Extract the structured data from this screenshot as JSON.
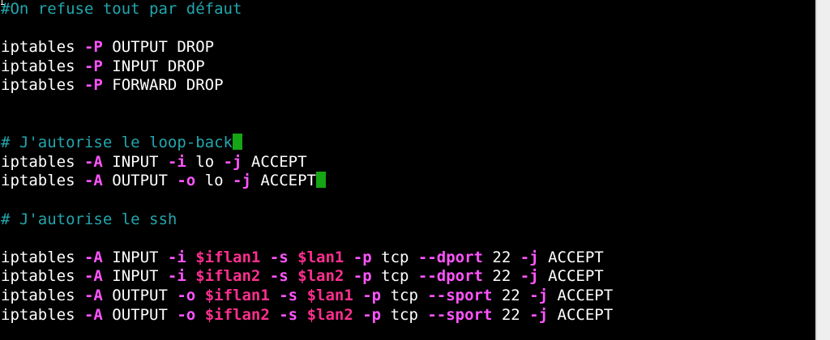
{
  "editor": {
    "lines": [
      [
        {
          "text": "#On refuse tout par défaut",
          "kind": "comment"
        }
      ],
      [],
      [
        {
          "text": "iptables ",
          "kind": "plain"
        },
        {
          "text": "-P",
          "kind": "option"
        },
        {
          "text": " OUTPUT DROP",
          "kind": "plain"
        }
      ],
      [
        {
          "text": "iptables ",
          "kind": "plain"
        },
        {
          "text": "-P",
          "kind": "option"
        },
        {
          "text": " INPUT DROP",
          "kind": "plain"
        }
      ],
      [
        {
          "text": "iptables ",
          "kind": "plain"
        },
        {
          "text": "-P",
          "kind": "option"
        },
        {
          "text": " FORWARD DROP",
          "kind": "plain"
        }
      ],
      [],
      [],
      [
        {
          "text": "# J'autorise le loop-back",
          "kind": "comment"
        },
        {
          "kind": "cursor"
        }
      ],
      [
        {
          "text": "iptables ",
          "kind": "plain"
        },
        {
          "text": "-A",
          "kind": "option"
        },
        {
          "text": " INPUT ",
          "kind": "plain"
        },
        {
          "text": "-i",
          "kind": "option"
        },
        {
          "text": " lo ",
          "kind": "plain"
        },
        {
          "text": "-j",
          "kind": "option"
        },
        {
          "text": " ACCEPT",
          "kind": "plain"
        }
      ],
      [
        {
          "text": "iptables ",
          "kind": "plain"
        },
        {
          "text": "-A",
          "kind": "option"
        },
        {
          "text": " OUTPUT ",
          "kind": "plain"
        },
        {
          "text": "-o",
          "kind": "option"
        },
        {
          "text": " lo ",
          "kind": "plain"
        },
        {
          "text": "-j",
          "kind": "option"
        },
        {
          "text": " ACCEPT",
          "kind": "plain"
        },
        {
          "kind": "cursor"
        }
      ],
      [],
      [
        {
          "text": "# J'autorise le ssh",
          "kind": "comment"
        }
      ],
      [],
      [
        {
          "text": "iptables ",
          "kind": "plain"
        },
        {
          "text": "-A",
          "kind": "option"
        },
        {
          "text": " INPUT ",
          "kind": "plain"
        },
        {
          "text": "-i",
          "kind": "option"
        },
        {
          "text": " ",
          "kind": "plain"
        },
        {
          "text": "$iflan1",
          "kind": "variable"
        },
        {
          "text": " ",
          "kind": "plain"
        },
        {
          "text": "-s",
          "kind": "option"
        },
        {
          "text": " ",
          "kind": "plain"
        },
        {
          "text": "$lan1",
          "kind": "variable"
        },
        {
          "text": " ",
          "kind": "plain"
        },
        {
          "text": "-p",
          "kind": "option"
        },
        {
          "text": " tcp ",
          "kind": "plain"
        },
        {
          "text": "--dport",
          "kind": "option"
        },
        {
          "text": " 22 ",
          "kind": "plain"
        },
        {
          "text": "-j",
          "kind": "option"
        },
        {
          "text": " ACCEPT",
          "kind": "plain"
        }
      ],
      [
        {
          "text": "iptables ",
          "kind": "plain"
        },
        {
          "text": "-A",
          "kind": "option"
        },
        {
          "text": " INPUT ",
          "kind": "plain"
        },
        {
          "text": "-i",
          "kind": "option"
        },
        {
          "text": " ",
          "kind": "plain"
        },
        {
          "text": "$iflan2",
          "kind": "variable"
        },
        {
          "text": " ",
          "kind": "plain"
        },
        {
          "text": "-s",
          "kind": "option"
        },
        {
          "text": " ",
          "kind": "plain"
        },
        {
          "text": "$lan2",
          "kind": "variable"
        },
        {
          "text": " ",
          "kind": "plain"
        },
        {
          "text": "-p",
          "kind": "option"
        },
        {
          "text": " tcp ",
          "kind": "plain"
        },
        {
          "text": "--dport",
          "kind": "option"
        },
        {
          "text": " 22 ",
          "kind": "plain"
        },
        {
          "text": "-j",
          "kind": "option"
        },
        {
          "text": " ACCEPT",
          "kind": "plain"
        }
      ],
      [
        {
          "text": "iptables ",
          "kind": "plain"
        },
        {
          "text": "-A",
          "kind": "option"
        },
        {
          "text": " OUTPUT ",
          "kind": "plain"
        },
        {
          "text": "-o",
          "kind": "option"
        },
        {
          "text": " ",
          "kind": "plain"
        },
        {
          "text": "$iflan1",
          "kind": "variable"
        },
        {
          "text": " ",
          "kind": "plain"
        },
        {
          "text": "-s",
          "kind": "option"
        },
        {
          "text": " ",
          "kind": "plain"
        },
        {
          "text": "$lan1",
          "kind": "variable"
        },
        {
          "text": " ",
          "kind": "plain"
        },
        {
          "text": "-p",
          "kind": "option"
        },
        {
          "text": " tcp ",
          "kind": "plain"
        },
        {
          "text": "--sport",
          "kind": "option"
        },
        {
          "text": " 22 ",
          "kind": "plain"
        },
        {
          "text": "-j",
          "kind": "option"
        },
        {
          "text": " ACCEPT",
          "kind": "plain"
        }
      ],
      [
        {
          "text": "iptables ",
          "kind": "plain"
        },
        {
          "text": "-A",
          "kind": "option"
        },
        {
          "text": " OUTPUT ",
          "kind": "plain"
        },
        {
          "text": "-o",
          "kind": "option"
        },
        {
          "text": " ",
          "kind": "plain"
        },
        {
          "text": "$iflan2",
          "kind": "variable"
        },
        {
          "text": " ",
          "kind": "plain"
        },
        {
          "text": "-s",
          "kind": "option"
        },
        {
          "text": " ",
          "kind": "plain"
        },
        {
          "text": "$lan2",
          "kind": "variable"
        },
        {
          "text": " ",
          "kind": "plain"
        },
        {
          "text": "-p",
          "kind": "option"
        },
        {
          "text": " tcp ",
          "kind": "plain"
        },
        {
          "text": "--sport",
          "kind": "option"
        },
        {
          "text": " 22 ",
          "kind": "plain"
        },
        {
          "text": "-j",
          "kind": "option"
        },
        {
          "text": " ACCEPT",
          "kind": "plain"
        }
      ]
    ]
  },
  "colors": {
    "background": "#000000",
    "plain": "#ffffff",
    "comment": "#22a6ad",
    "option": "#ff55ff",
    "variable": "#ff2f8f",
    "cursor": "#15a515",
    "border": "#efefef"
  },
  "icons": {
    "corner_marker": "cursor-corner-icon",
    "text_cursor": "text-cursor-icon"
  }
}
